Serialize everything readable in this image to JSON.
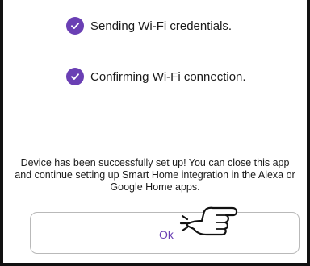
{
  "steps": [
    {
      "label": "Sending Wi-Fi credentials.",
      "status": "done",
      "icon": "check-circle-icon"
    },
    {
      "label": "Confirming Wi-Fi connection.",
      "status": "done",
      "icon": "check-circle-icon"
    }
  ],
  "message": "Device has been successfully set up! You can close this app and continue setting up Smart Home integration in the Alexa or Google Home apps.",
  "ok_button": {
    "label": "Ok"
  },
  "pointer": {
    "icon": "hand-pointer-icon"
  },
  "colors": {
    "accent": "#6a3fb4",
    "ok_text": "#6a3fb4",
    "text": "#1a1a1a",
    "border": "#b9b9b9"
  }
}
